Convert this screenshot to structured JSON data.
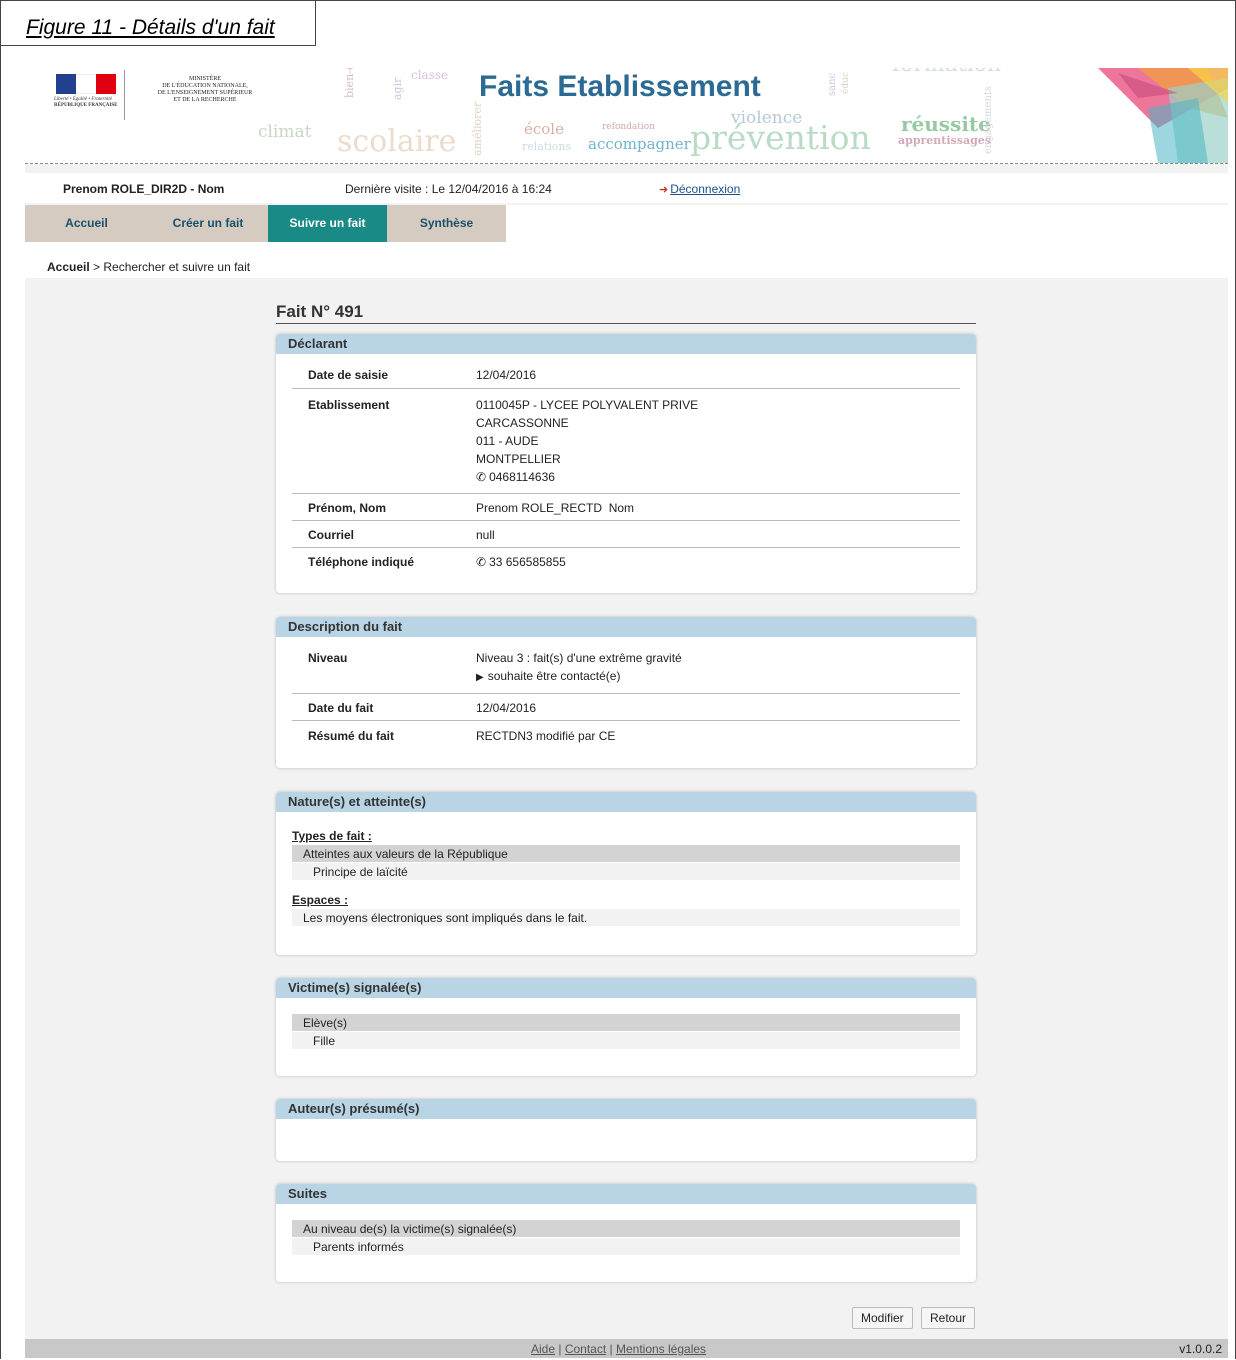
{
  "figure_caption": "Figure 11 - Détails d'un fait",
  "banner": {
    "title": "Faits Etablissement",
    "ministere": [
      "MINISTÈRE",
      "DE L'ÉDUCATION NATIONALE,",
      "DE L'ENSEIGNEMENT SUPÉRIEUR",
      "ET DE LA RECHERCHE"
    ],
    "republique": [
      "Liberté • Égalité • Fraternité",
      "RÉPUBLIQUE FRANÇAISE"
    ],
    "words": {
      "classe": "classe",
      "agir": "agir",
      "bien_etre": "bien-être",
      "climat": "climat",
      "scolaire": "scolaire",
      "ameliorer": "améliorer",
      "ecole": "école",
      "relations": "relations",
      "refondation": "refondation",
      "accompagner": "accompagner",
      "violence": "violence",
      "prevention": "prévention",
      "reussite": "réussite",
      "apprentissages": "apprentissages",
      "formation": "formation",
      "engagements": "engagements",
      "sanc": "sanc",
      "educ": "éduc"
    }
  },
  "user": {
    "name": "Prenom ROLE_DIR2D - Nom",
    "last_visit": "Dernière visite : Le 12/04/2016 à 16:24",
    "logout": "Déconnexion"
  },
  "tabs": [
    {
      "label": "Accueil"
    },
    {
      "label": "Créer un fait"
    },
    {
      "label": "Suivre un fait"
    },
    {
      "label": "Synthèse"
    }
  ],
  "breadcrumb": {
    "root": "Accueil",
    "current": " > Rechercher et suivre un fait"
  },
  "fait_title": "Fait N° 491",
  "declarant": {
    "header": "Déclarant",
    "date_saisie_label": "Date de saisie",
    "date_saisie": "12/04/2016",
    "etab_label": "Etablissement",
    "etab_lines": [
      "0110045P - LYCEE POLYVALENT PRIVE",
      "CARCASSONNE",
      "011 - AUDE",
      "MONTPELLIER",
      "0468114636"
    ],
    "nom_label": "Prénom, Nom",
    "nom": "Prenom ROLE_RECTD  Nom",
    "courriel_label": "Courriel",
    "courriel": "null",
    "tel_label": "Téléphone indiqué",
    "tel": "33 656585855"
  },
  "description": {
    "header": "Description du fait",
    "niveau_label": "Niveau",
    "niveau": "Niveau 3 : fait(s) d'une extrême gravité",
    "contact": "souhaite être contacté(e)",
    "date_label": "Date du fait",
    "date": "12/04/2016",
    "resume_label": "Résumé du fait",
    "resume": "RECTDN3 modifié par CE"
  },
  "nature": {
    "header": "Nature(s) et atteinte(s)",
    "types_label": "Types de fait :",
    "type_group": "Atteintes aux valeurs de la République",
    "type_item": "Principe de laïcité",
    "espaces_label": "Espaces :",
    "espace_item": "Les moyens électroniques sont impliqués dans le fait."
  },
  "victimes": {
    "header": "Victime(s) signalée(s)",
    "group": "Elève(s)",
    "item": "Fille"
  },
  "auteurs": {
    "header": "Auteur(s) présumé(s)"
  },
  "suites": {
    "header": "Suites",
    "group": "Au niveau de(s) la victime(s) signalée(s)",
    "item": "Parents informés"
  },
  "buttons": {
    "modifier": "Modifier",
    "retour": "Retour"
  },
  "footer": {
    "aide": "Aide",
    "contact": "Contact",
    "mentions": "Mentions légales",
    "sep": " | ",
    "version": "v1.0.0.2"
  },
  "colors": {
    "tab_active": "#1a8a86",
    "tab_inactive": "#d6cbc1",
    "panel_header": "#b9d5e5",
    "banner_title": "#2b6a93"
  }
}
